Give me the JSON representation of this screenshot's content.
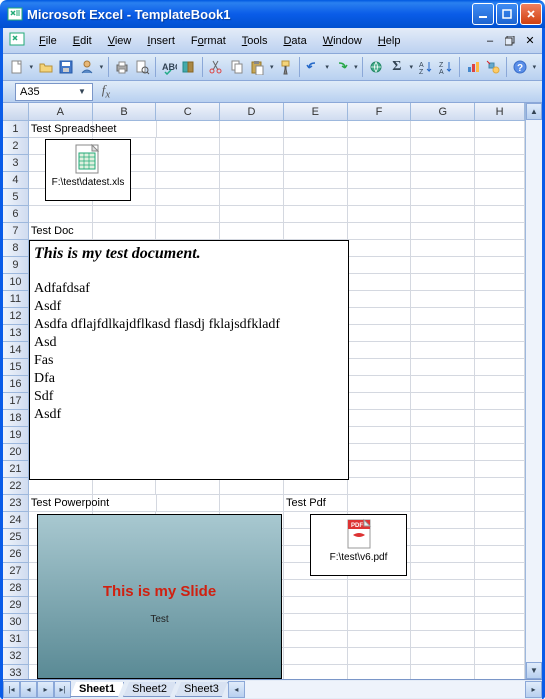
{
  "titlebar": {
    "app": "Microsoft Excel",
    "doc": "TemplateBook1"
  },
  "menu": {
    "file": "File",
    "edit": "Edit",
    "view": "View",
    "insert": "Insert",
    "format": "Format",
    "tools": "Tools",
    "data": "Data",
    "window": "Window",
    "help": "Help"
  },
  "namebox": {
    "value": "A35"
  },
  "columns": [
    "A",
    "B",
    "C",
    "D",
    "E",
    "F",
    "G",
    "H"
  ],
  "rows": 34,
  "cells": {
    "A1": "Test Spreadsheet",
    "A7": "Test Doc",
    "A23": "Test Powerpoint",
    "E23": "Test Pdf"
  },
  "embeds": {
    "xls": {
      "path": "F:\\test\\datest.xls"
    },
    "doc": {
      "heading": "This is my test document.",
      "lines": [
        "Adfafdsaf",
        "Asdf",
        "Asdfa dflajfdlkajdflkasd flasdj fklajsdfkladf",
        "Asd",
        "Fas",
        "Dfa",
        "Sdf",
        "Asdf"
      ]
    },
    "ppt": {
      "title": "This is my Slide",
      "subtitle": "Test"
    },
    "pdf": {
      "path": "F:\\test\\v6.pdf"
    }
  },
  "sheets": {
    "s1": "Sheet1",
    "s2": "Sheet2",
    "s3": "Sheet3"
  }
}
